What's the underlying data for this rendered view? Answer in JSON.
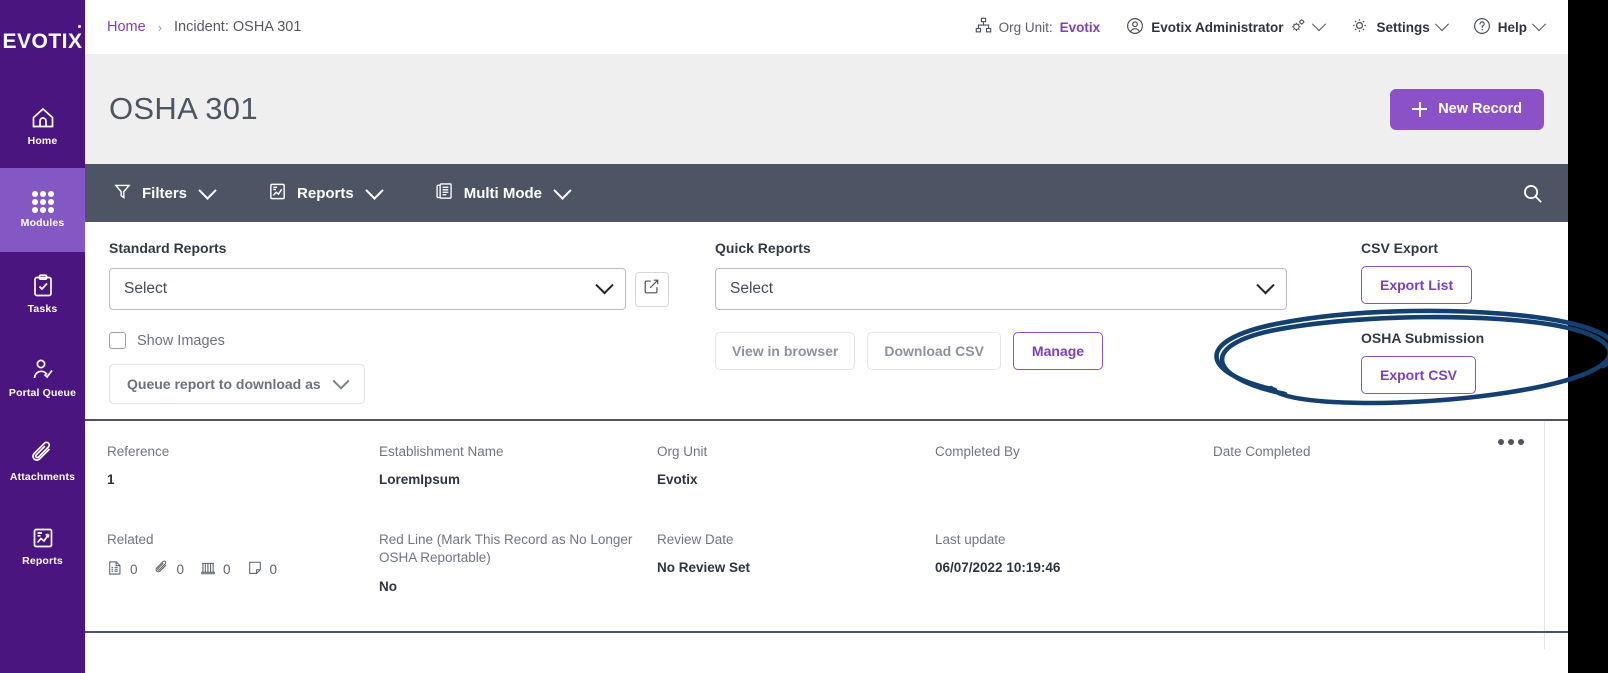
{
  "brand": {
    "logo_text": "EVOTIX",
    "purple": "#4B1580",
    "purple_active": "#8357C4",
    "accent": "#8B52C8",
    "accent_text": "#7B3FC4",
    "toolbar_dark": "#4D5463",
    "page_head_bg": "#EFEFEF",
    "annotation_color": "#13406F"
  },
  "sidebar": {
    "items": [
      {
        "label": "Home",
        "icon": "home-icon",
        "active": false
      },
      {
        "label": "Modules",
        "icon": "grid-dots-icon",
        "active": true
      },
      {
        "label": "Tasks",
        "icon": "clipboard-check-icon",
        "active": false
      },
      {
        "label": "Portal Queue",
        "icon": "user-check-icon",
        "active": false
      },
      {
        "label": "Attachments",
        "icon": "paperclip-icon",
        "active": false
      },
      {
        "label": "Reports",
        "icon": "report-chart-icon",
        "active": false
      }
    ]
  },
  "breadcrumb": {
    "home": "Home",
    "separator": "›",
    "current": "Incident: OSHA 301"
  },
  "header": {
    "org_unit_label": "Org Unit:",
    "org_unit_value": "Evotix",
    "org_unit_icon": "org-tree-icon",
    "user_name": "Evotix Administrator",
    "user_icon": "user-circle-icon",
    "user_gear_icon": "gears-icon",
    "settings_label": "Settings",
    "settings_icon": "gear-icon",
    "help_label": "Help",
    "help_icon": "question-circle-icon"
  },
  "page": {
    "title": "OSHA 301",
    "new_record_label": "New Record"
  },
  "toolbar": {
    "items": [
      {
        "label": "Filters",
        "icon": "funnel-icon"
      },
      {
        "label": "Reports",
        "icon": "report-chart-icon"
      },
      {
        "label": "Multi Mode",
        "icon": "multi-copy-icon"
      }
    ],
    "search_icon": "search-icon"
  },
  "reports_panel": {
    "standard": {
      "label": "Standard Reports",
      "select_value": "Select",
      "edit_icon": "edit-square-icon",
      "show_images_label": "Show Images",
      "show_images_checked": false,
      "queue_label": "Queue report to download as"
    },
    "quick": {
      "label": "Quick Reports",
      "select_value": "Select",
      "buttons": [
        {
          "label": "View in browser",
          "style": "ghost"
        },
        {
          "label": "Download CSV",
          "style": "ghost"
        },
        {
          "label": "Manage",
          "style": "purple"
        }
      ]
    },
    "csv_export": {
      "label": "CSV Export",
      "button_label": "Export List"
    },
    "osha_submission": {
      "label": "OSHA Submission",
      "button_label": "Export CSV"
    }
  },
  "record_list": {
    "row1": [
      {
        "label": "Reference",
        "value": "1"
      },
      {
        "label": "Establishment Name",
        "value": "LoremIpsum"
      },
      {
        "label": "Org Unit",
        "value": "Evotix"
      },
      {
        "label": "Completed By",
        "value": ""
      },
      {
        "label": "Date Completed",
        "value": ""
      }
    ],
    "row2": [
      {
        "label": "Related",
        "value": ""
      },
      {
        "label": "Red Line (Mark This Record as No Longer OSHA Reportable)",
        "value": "No"
      },
      {
        "label": "Review Date",
        "value": "No Review Set"
      },
      {
        "label": "Last update",
        "value": "06/07/2022 10:19:46"
      }
    ],
    "related_counts": [
      {
        "icon": "form-icon",
        "count": "0"
      },
      {
        "icon": "paperclip-icon",
        "count": "0"
      },
      {
        "icon": "book-icon",
        "count": "0"
      },
      {
        "icon": "note-icon",
        "count": "0"
      }
    ],
    "kebab_icon": "more-options-icon"
  },
  "annotation": {
    "shape": "hand-drawn-ellipse",
    "target": "OSHA Submission / Export CSV"
  }
}
